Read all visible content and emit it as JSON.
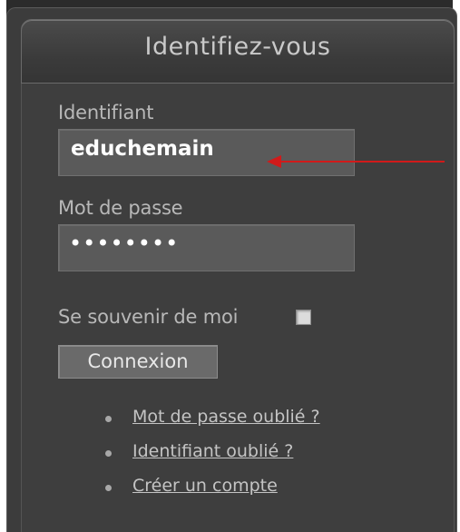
{
  "title": "Identifiez-vous",
  "username": {
    "label": "Identifiant",
    "value": "educhemain"
  },
  "password": {
    "label": "Mot de passe",
    "value": "••••••••"
  },
  "remember": {
    "label": "Se souvenir de moi",
    "checked": false
  },
  "login_button": "Connexion",
  "links": [
    "Mot de passe oublié ?",
    "Identifiant oublié ?",
    "Créer un compte"
  ],
  "colors": {
    "annotation_arrow": "#d11a1a",
    "panel_background": "#3e3e3e"
  }
}
